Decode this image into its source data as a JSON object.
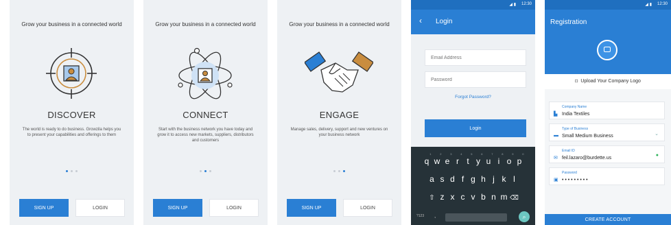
{
  "screens": {
    "discover": {
      "tagline": "Grow your business in a connected world",
      "title": "DISCOVER",
      "description": "The world is ready to do business. Growzila helps you to present your capabilities and offerings to them",
      "signup_label": "SIGN UP",
      "login_label": "LOGIN",
      "active_dot": 1
    },
    "connect": {
      "tagline": "Grow your business in a connected world",
      "title": "CONNECT",
      "description": "Start with the business network you have today and grow it to access new markets, suppliers, distributors and customers",
      "signup_label": "SIGN UP",
      "login_label": "LOGIN",
      "active_dot": 2
    },
    "engage": {
      "tagline": "Grow your business in a connected world",
      "title": "ENGAGE",
      "description": "Manage sales, delivery, support and new ventures on your business network",
      "signup_label": "SIGN UP",
      "login_label": "LOGIN",
      "active_dot": 3
    },
    "login": {
      "status_time": "12:30",
      "title": "Login",
      "email_placeholder": "Email Address",
      "password_placeholder": "Password",
      "forgot_label": "Forgot Password?",
      "login_button": "Login",
      "keyboard": {
        "row1": [
          "q",
          "w",
          "e",
          "r",
          "t",
          "y",
          "u",
          "i",
          "o",
          "p"
        ],
        "row1_hints": [
          "1",
          "2",
          "3",
          "4",
          "5",
          "6",
          "7",
          "8",
          "9",
          "0"
        ],
        "row2": [
          "a",
          "s",
          "d",
          "f",
          "g",
          "h",
          "j",
          "k",
          "l"
        ],
        "row3": [
          "z",
          "x",
          "c",
          "v",
          "b",
          "n",
          "m"
        ],
        "num_key": "?123",
        "comma_key": ","
      }
    },
    "registration": {
      "status_time": "12:30",
      "title": "Registration",
      "upload_label": "Upload Your Company Logo",
      "fields": [
        {
          "label": "Company Name",
          "value": "India Textiles",
          "icon": "building-icon"
        },
        {
          "label": "Type of Business",
          "value": "Small Medium Business",
          "icon": "briefcase-icon"
        },
        {
          "label": "Email ID",
          "value": "feil.lazaro@burdette.us",
          "icon": "mail-icon"
        },
        {
          "label": "Password",
          "value": "• • • • • • • • •",
          "icon": "lock-icon"
        }
      ],
      "create_button": "CREATE ACCOUNT"
    }
  },
  "colors": {
    "primary": "#2a7fd4",
    "primary_dark": "#1f6fbf",
    "accent_orange": "#c98d3f",
    "background": "#eef1f4",
    "keyboard": "#263238"
  }
}
